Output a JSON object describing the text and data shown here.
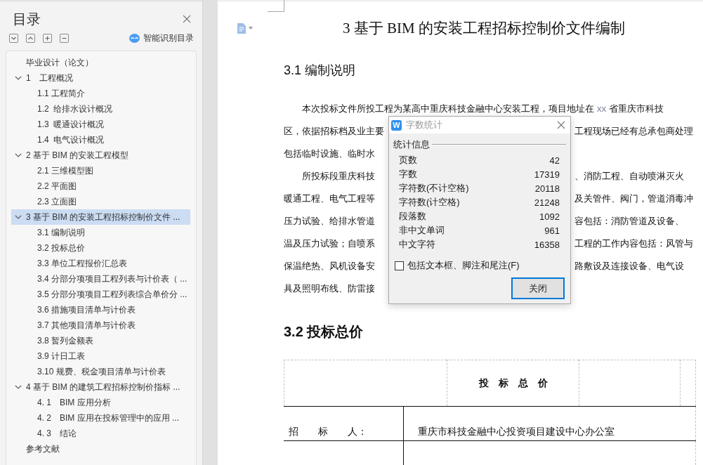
{
  "sidebar": {
    "title": "目录",
    "smart_toc": "智能识别目录",
    "tree": [
      {
        "text": "毕业设计（论文）",
        "selected": false
      },
      {
        "text": "1　工程概况",
        "selected": false,
        "expanded": true,
        "children": [
          {
            "text": "1.1 工程简介",
            "selected": false
          },
          {
            "text": "1.2  给排水设计概况",
            "selected": false
          },
          {
            "text": "1.3  暖通设计概况",
            "selected": false
          },
          {
            "text": "1.4  电气设计概况",
            "selected": false
          }
        ]
      },
      {
        "text": "2 基于 BIM 的安装工程模型",
        "selected": false,
        "expanded": true,
        "children": [
          {
            "text": "2.1 三维模型图",
            "selected": false
          },
          {
            "text": "2.2 平面图",
            "selected": false
          },
          {
            "text": "2.3 立面图",
            "selected": false
          }
        ]
      },
      {
        "text": "3 基于 BIM 的安装工程招标控制价文件 ...",
        "selected": true,
        "expanded": true,
        "children": [
          {
            "text": "3.1 编制说明",
            "selected": false
          },
          {
            "text": "3.2 投标总价",
            "selected": false
          },
          {
            "text": "3.3 单位工程报价汇总表",
            "selected": false
          },
          {
            "text": "3.4 分部分项项目工程列表与计价表（ ...",
            "selected": false
          },
          {
            "text": "3.5 分部分项项目工程列表综合单价分 ...",
            "selected": false
          },
          {
            "text": "3.6 措施项目清单与计价表",
            "selected": false
          },
          {
            "text": "3.7 其他项目清单与计价表",
            "selected": false
          },
          {
            "text": "3.8 暂列金额表",
            "selected": false
          },
          {
            "text": "3.9 计日工表",
            "selected": false
          },
          {
            "text": "3.10 规费、税金项目清单与计价表",
            "selected": false
          }
        ]
      },
      {
        "text": "4 基于 BIM 的建筑工程招标控制价指标 ...",
        "selected": false,
        "expanded": true,
        "children": [
          {
            "text": "4. 1　BIM 应用分析",
            "selected": false
          },
          {
            "text": "4. 2　BIM 应用在投标管理中的应用 ...",
            "selected": false
          },
          {
            "text": "4. 3　结论",
            "selected": false
          }
        ]
      },
      {
        "text": "参考文献",
        "selected": false
      }
    ]
  },
  "document": {
    "title": "3 基于 BIM 的安装工程招标控制价文件编制",
    "subheading": "3.1 编制说明",
    "paragraphs": [
      {
        "lines": [
          {
            "left": "本次投标文件所投工程为某高中重庆科技金融中心安装工程，项目地址在",
            "field": "xx",
            "after": "省重庆市科技"
          },
          {
            "left": "区，依据招标档及业主要",
            "right": "工程现场已经有总承包商处理"
          },
          {
            "left": "包括临时设施、临时水"
          }
        ]
      },
      {
        "lines": [
          {
            "left": "所投标段重庆科技",
            "right": "、消防工程、自动喷淋灭火"
          },
          {
            "left": "暖通工程、电气工程等",
            "right": "及关管件、阀门，管道消毒冲"
          },
          {
            "left": "压力试验、给排水管道",
            "right": "容包括：消防管道及设备、"
          },
          {
            "left": "温及压力试验；自喷系",
            "right": "工程的工作内容包括：风管与"
          },
          {
            "left": "保温绝热、风机设备安",
            "right": "路敷设及连接设备、电气设"
          },
          {
            "left": "具及照明布线、防雷接"
          }
        ]
      }
    ],
    "table_heading": "3.2 投标总价",
    "table": {
      "header": "投　标　总　价",
      "rows": [
        {
          "label": "招　　标　　人：",
          "value": "重庆市科技金融中心投资项目建设中心办公室"
        }
      ]
    }
  },
  "dialog": {
    "icon": "W",
    "title": "字数统计",
    "group": "统计信息",
    "stats": [
      {
        "label": "页数",
        "value": "42"
      },
      {
        "label": "字数",
        "value": "17319"
      },
      {
        "label": "字符数(不计空格)",
        "value": "20118"
      },
      {
        "label": "字符数(计空格)",
        "value": "21248"
      },
      {
        "label": "段落数",
        "value": "1092"
      },
      {
        "label": "非中文单词",
        "value": "961"
      },
      {
        "label": "中文字符",
        "value": "16358"
      }
    ],
    "option": {
      "label": "包括文本框、脚注和尾注(F)",
      "checked": false
    },
    "button": {
      "label": "关闭",
      "focused": true
    }
  }
}
